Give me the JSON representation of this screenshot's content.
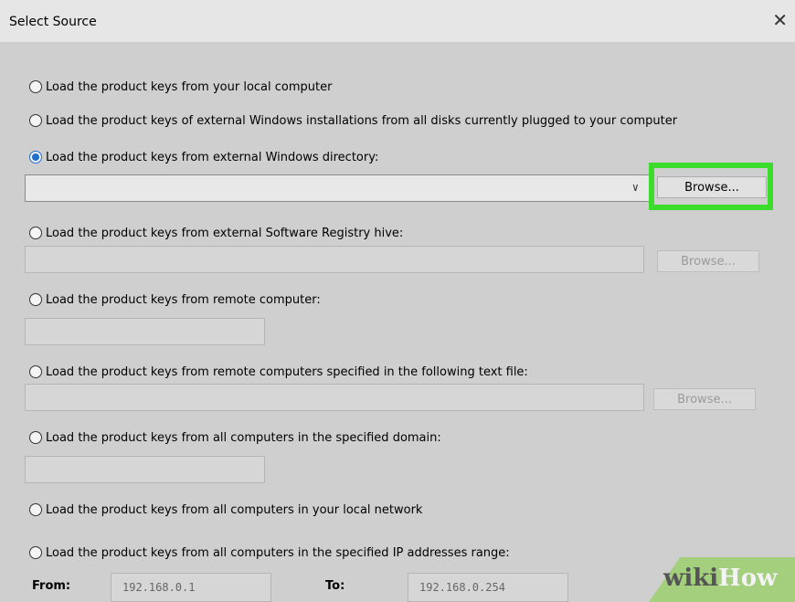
{
  "dialog": {
    "title": "Select Source",
    "close_glyph": "✕"
  },
  "options": [
    {
      "label": "Load the product keys from your local computer",
      "selected": false
    },
    {
      "label": "Load the product keys of external Windows installations from all disks currently plugged to your computer",
      "selected": false
    },
    {
      "label": "Load the product keys from external Windows directory:",
      "selected": true
    },
    {
      "label": "Load the product keys from external Software Registry hive:",
      "selected": false
    },
    {
      "label": "Load the product keys from remote computer:",
      "selected": false
    },
    {
      "label": "Load the product keys from remote computers specified in the following text file:",
      "selected": false
    },
    {
      "label": "Load the product keys from all computers in the specified domain:",
      "selected": false
    },
    {
      "label": "Load the product keys from all computers in your local network",
      "selected": false
    },
    {
      "label": "Load the product keys from all computers in the specified IP addresses range:",
      "selected": false
    }
  ],
  "buttons": {
    "browse_label": "Browse..."
  },
  "fields": {
    "windows_directory": "",
    "registry_hive": "",
    "remote_computer": "",
    "text_file": "",
    "domain": ""
  },
  "ip_range": {
    "from_label": "From:",
    "from_value": "192.168.0.1",
    "to_label": "To:",
    "to_value": "192.168.0.254"
  },
  "watermark": {
    "wiki": "wiki",
    "how": "How"
  },
  "icons": {
    "dropdown": "chevron-down-icon",
    "close": "close-icon"
  },
  "colors": {
    "highlight": "#3bdc2c",
    "radio_selected": "#1f6fd0",
    "background": "#cfcfcf"
  }
}
